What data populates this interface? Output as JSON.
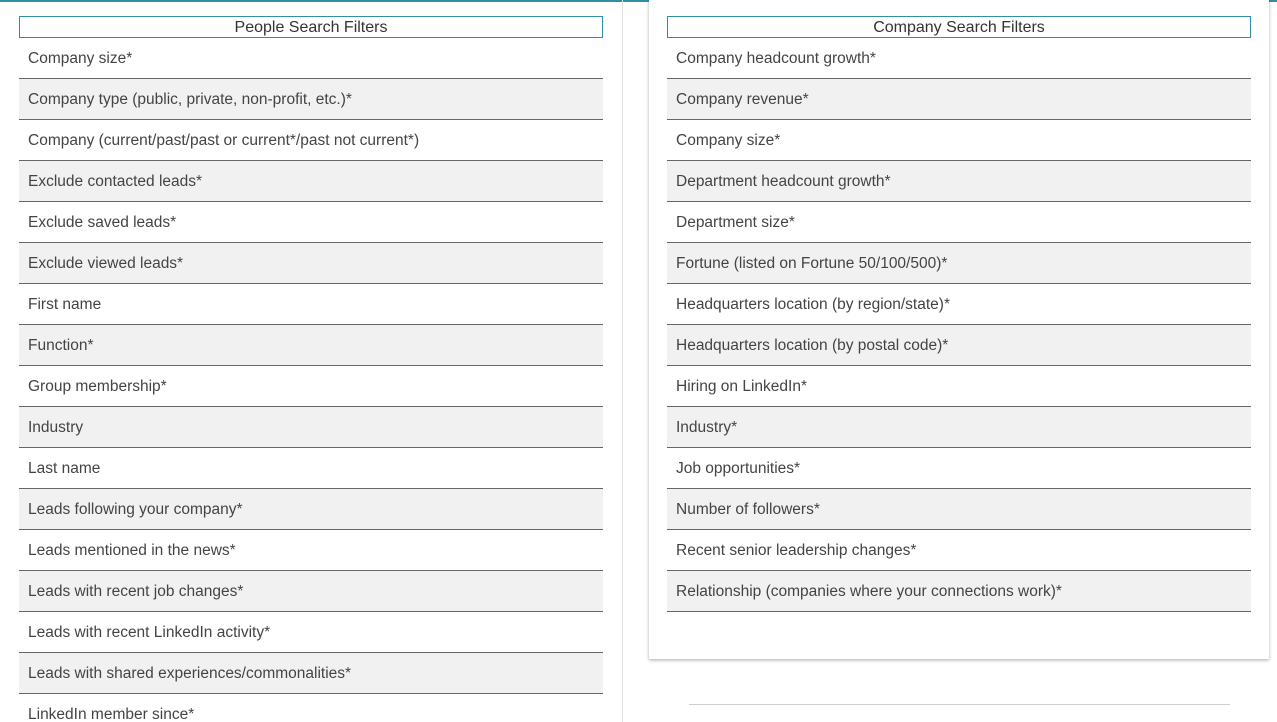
{
  "people": {
    "title": "People Search Filters",
    "rows": [
      "Company size*",
      "Company type (public, private, non-profit, etc.)*",
      "Company (current/past/past or current*/past not current*)",
      "Exclude contacted leads*",
      "Exclude saved leads*",
      "Exclude viewed leads*",
      "First name",
      "Function*",
      "Group membership*",
      "Industry",
      "Last name",
      "Leads following your company*",
      "Leads mentioned in the news*",
      "Leads with recent job changes*",
      "Leads with recent LinkedIn activity*",
      "Leads with shared experiences/commonalities*",
      "LinkedIn member since*"
    ]
  },
  "company": {
    "title": "Company Search Filters",
    "rows": [
      "Company headcount growth*",
      "Company revenue*",
      "Company size*",
      "Department headcount growth*",
      "Department size*",
      "Fortune (listed on Fortune 50/100/500)*",
      "Headquarters location (by region/state)*",
      "Headquarters location (by postal code)*",
      "Hiring on LinkedIn*",
      "Industry*",
      "Job opportunities*",
      "Number of followers*",
      "Recent senior leadership changes*",
      "Relationship (companies where your connections work)*"
    ]
  },
  "colors": {
    "accent": "#2e8fa5",
    "row_shade": "#f1f1f1",
    "row_rule": "#666666",
    "text": "#444444"
  }
}
